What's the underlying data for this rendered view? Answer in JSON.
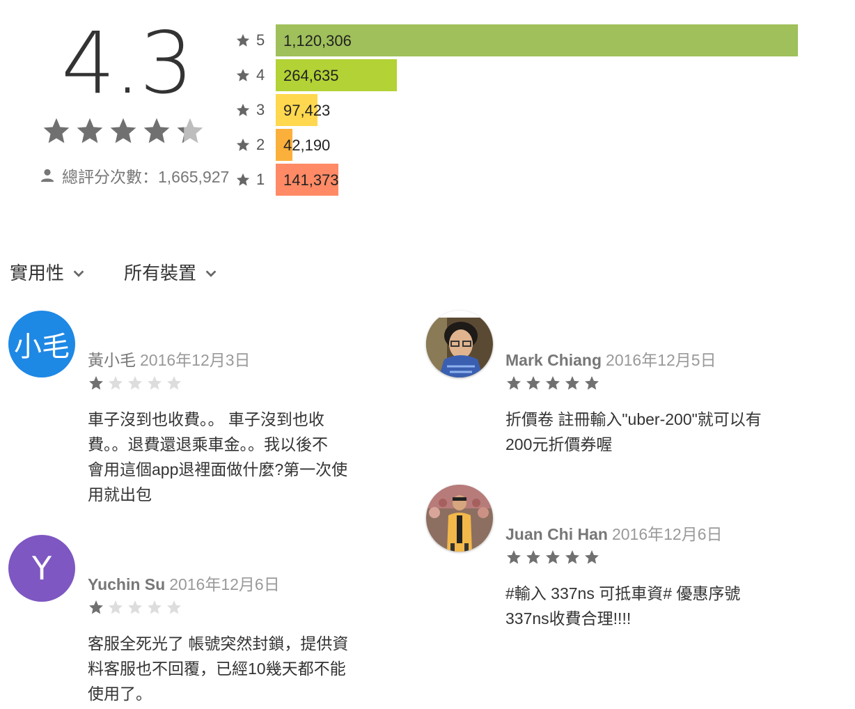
{
  "summary": {
    "score": "4.3",
    "star_rating": 4.3,
    "total_label": "總評分次數：1,665,927",
    "histogram": [
      {
        "star": "5",
        "count": "1,120,306",
        "color": "#9fc05a"
      },
      {
        "star": "4",
        "count": "264,635",
        "color": "#b2d235"
      },
      {
        "star": "3",
        "count": "97,423",
        "color": "#ffd84f"
      },
      {
        "star": "2",
        "count": "42,190",
        "color": "#fbb03b"
      },
      {
        "star": "1",
        "count": "141,373",
        "color": "#ff8a65"
      }
    ]
  },
  "filters": {
    "sort_label": "實用性",
    "device_label": "所有裝置"
  },
  "reviews": [
    {
      "avatar_letter": "小毛",
      "avatar_color": "#1e88e5",
      "author": "黃小毛",
      "date": "2016年12月3日",
      "rating": 1,
      "lines": [
        "車子沒到也收費。。 車子沒到也收",
        "費。。退費還退乘車金。。我以後不",
        "會用這個app退裡面做什麼?第一次使",
        "用就出包"
      ]
    },
    {
      "avatar_letter": "Y",
      "avatar_color": "#7e57c2",
      "author": "Yuchin Su",
      "date": "2016年12月6日",
      "rating": 1,
      "lines": [
        "客服全死光了 帳號突然封鎖，提供資",
        "料客服也不回覆，已經10幾天都不能",
        "使用了。"
      ]
    },
    {
      "avatar_icon": "user-photo-icon",
      "author": "Mark Chiang",
      "date": "2016年12月5日",
      "rating": 5,
      "lines": [
        "折價卷 註冊輸入\"uber-200\"就可以有",
        "200元折價券喔"
      ]
    },
    {
      "avatar_icon": "user-photo-icon",
      "author": "Juan Chi Han",
      "date": "2016年12月6日",
      "rating": 5,
      "lines": [
        "#輸入 337ns 可抵車資# 優惠序號",
        "337ns收費合理!!!!"
      ]
    }
  ],
  "icons": {
    "star": "star-icon",
    "person": "person-icon",
    "chevron": "chevron-down-icon"
  },
  "colors": {
    "star_filled": "#707070",
    "star_empty": "#dddddd"
  }
}
